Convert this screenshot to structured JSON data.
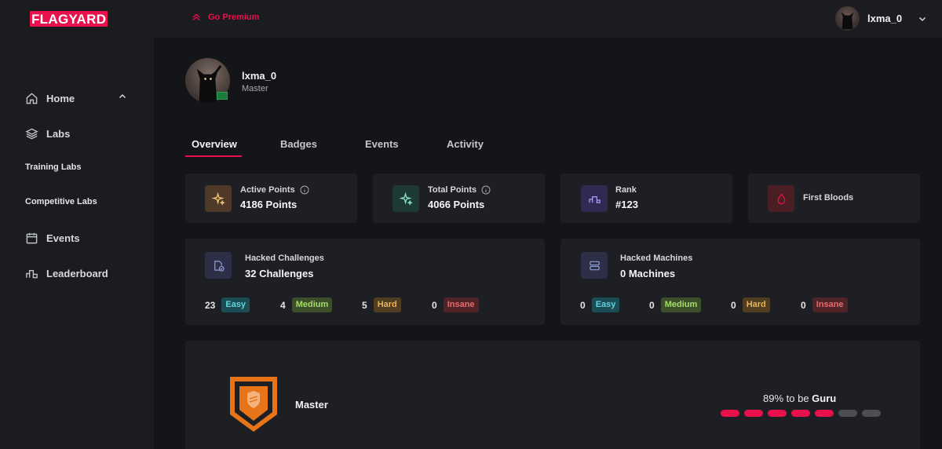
{
  "header": {
    "logo": "FLAGYARD",
    "premium_label": "Go Premium",
    "username": "lxma_0"
  },
  "sidebar": {
    "items": [
      {
        "label": "Home",
        "icon": "home-icon"
      },
      {
        "label": "Labs",
        "icon": "layers-icon"
      },
      {
        "label": "Training Labs"
      },
      {
        "label": "Competitive Labs"
      },
      {
        "label": "Events",
        "icon": "calendar-icon"
      },
      {
        "label": "Leaderboard",
        "icon": "leaderboard-icon"
      }
    ]
  },
  "profile": {
    "name": "lxma_0",
    "rank": "Master"
  },
  "tabs": [
    {
      "label": "Overview",
      "active": true
    },
    {
      "label": "Badges"
    },
    {
      "label": "Events"
    },
    {
      "label": "Activity"
    }
  ],
  "stats": {
    "active_points": {
      "label": "Active Points",
      "value": "4186 Points"
    },
    "total_points": {
      "label": "Total Points",
      "value": "4066 Points"
    },
    "rank": {
      "label": "Rank",
      "value": "#123"
    },
    "first_bloods": {
      "label": "First Bloods"
    }
  },
  "challenges": {
    "label": "Hacked Challenges",
    "value": "32 Challenges",
    "breakdown": [
      {
        "count": "23",
        "level": "Easy"
      },
      {
        "count": "4",
        "level": "Medium"
      },
      {
        "count": "5",
        "level": "Hard"
      },
      {
        "count": "0",
        "level": "Insane"
      }
    ]
  },
  "machines": {
    "label": "Hacked Machines",
    "value": "0 Machines",
    "breakdown": [
      {
        "count": "0",
        "level": "Easy"
      },
      {
        "count": "0",
        "level": "Medium"
      },
      {
        "count": "0",
        "level": "Hard"
      },
      {
        "count": "0",
        "level": "Insane"
      }
    ]
  },
  "level": {
    "title": "Master",
    "progress_prefix": "89% to be ",
    "next_rank": "Guru",
    "segments_total": 7,
    "segments_filled": 5
  },
  "colors": {
    "accent": "#e8114b",
    "easy": "#5fd3dd",
    "medium": "#a7dd6a",
    "hard": "#e8b25a",
    "insane": "#e86a6e"
  }
}
